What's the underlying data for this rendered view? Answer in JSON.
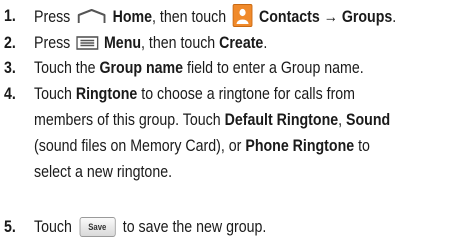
{
  "steps": [
    {
      "number": "1.",
      "parts": {
        "a": "Press",
        "home": "Home",
        "b": ", then touch",
        "contacts": "Contacts",
        "arrow": "→",
        "groups": "Groups",
        "end": "."
      }
    },
    {
      "number": "2.",
      "parts": {
        "a": "Press",
        "menu": "Menu",
        "b": ", then touch",
        "create": "Create",
        "end": "."
      }
    },
    {
      "number": "3.",
      "parts": {
        "a": "Touch the",
        "field": "Group name",
        "b": "field to enter a Group name."
      }
    },
    {
      "number": "4.",
      "lines": {
        "l1a": "Touch",
        "l1b": "Ringtone",
        "l1c": "to choose a ringtone for calls from",
        "l2a": "members of this group. Touch",
        "l2b": "Default Ringtone",
        "l2c": ",",
        "l2d": "Sound",
        "l3a": "(sound files on Memory Card), or",
        "l3b": "Phone Ringtone",
        "l3c": "to",
        "l4a": "select a new ringtone."
      }
    },
    {
      "number": "5.",
      "parts": {
        "a": "Touch",
        "button": "Save",
        "b": "to save the new group."
      }
    }
  ],
  "icons": {
    "home": "home-icon",
    "contacts": "contacts-icon",
    "menu": "menu-icon"
  },
  "colors": {
    "text": "#1a1a1a",
    "contacts_icon": "#f08a2b",
    "home_icon": "#555555"
  }
}
